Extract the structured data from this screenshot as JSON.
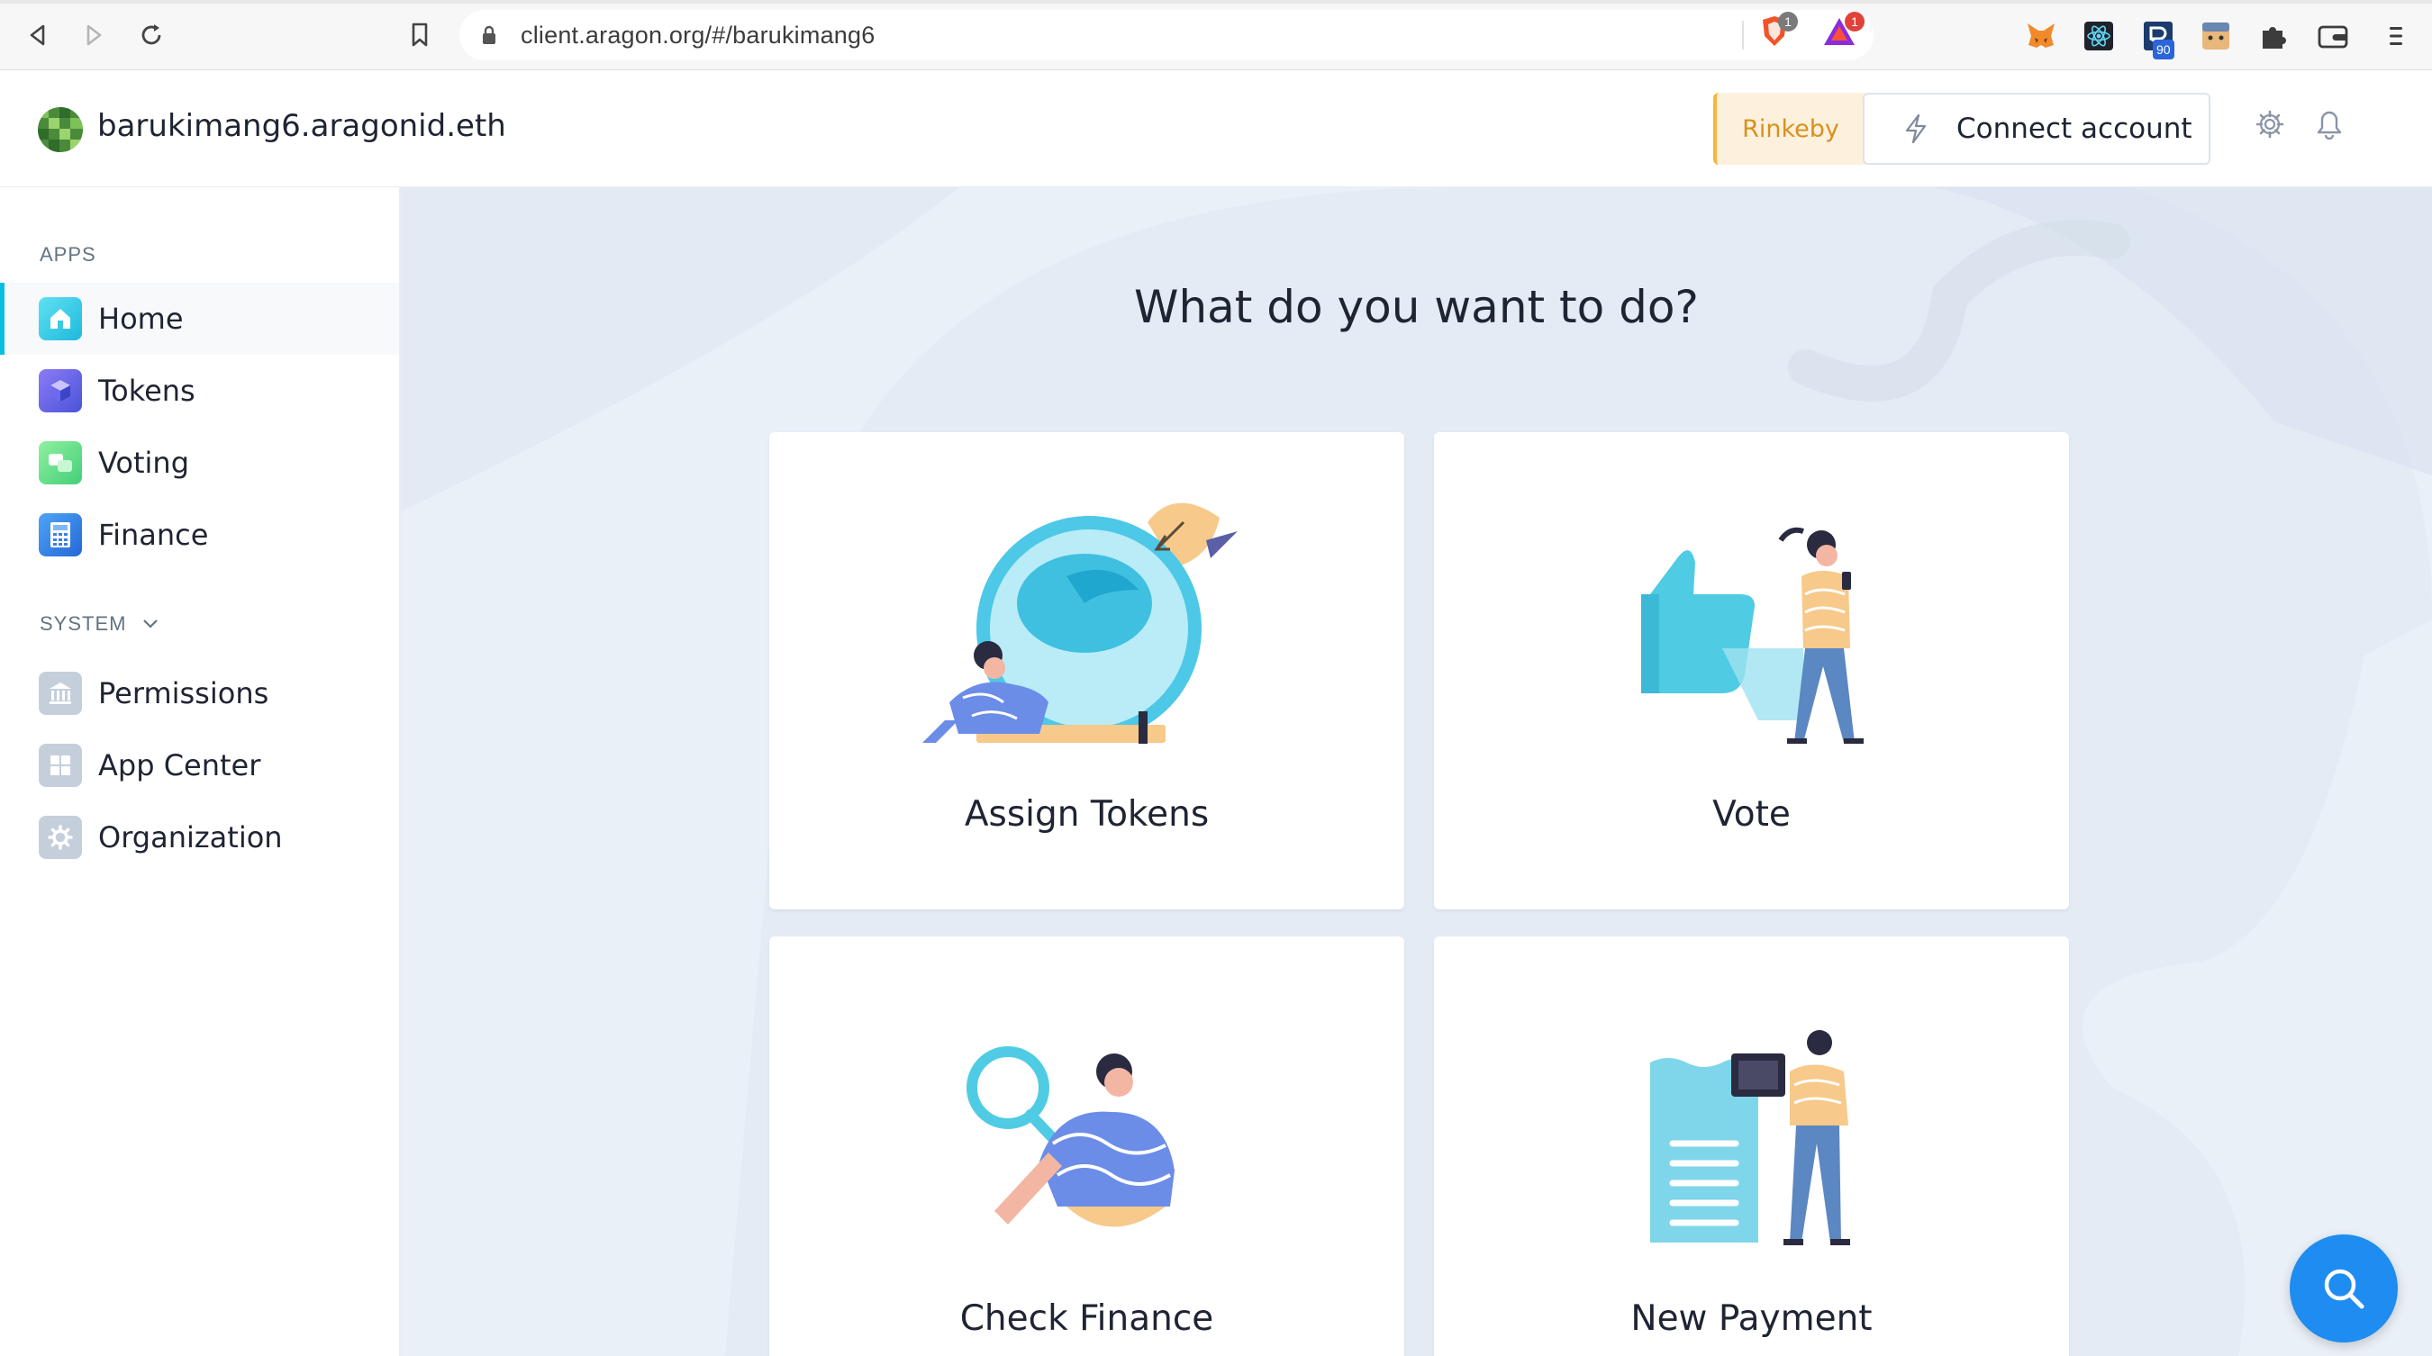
{
  "browser": {
    "url": "client.aragon.org/#/barukimang6",
    "brave_badge": "1",
    "rewards_badge": "1",
    "ext_badge": "90"
  },
  "header": {
    "org_name": "barukimang6.aragonid.eth",
    "network": "Rinkeby",
    "connect_label": "Connect account"
  },
  "sidebar": {
    "apps_label": "APPS",
    "apps": [
      {
        "label": "Home",
        "icon": "home-icon"
      },
      {
        "label": "Tokens",
        "icon": "tokens-icon"
      },
      {
        "label": "Voting",
        "icon": "voting-icon"
      },
      {
        "label": "Finance",
        "icon": "finance-icon"
      }
    ],
    "system_label": "SYSTEM",
    "system": [
      {
        "label": "Permissions",
        "icon": "permissions-icon"
      },
      {
        "label": "App Center",
        "icon": "app-center-icon"
      },
      {
        "label": "Organization",
        "icon": "organization-icon"
      }
    ]
  },
  "main": {
    "title": "What do you want to do?",
    "cards": [
      {
        "label": "Assign Tokens"
      },
      {
        "label": "Vote"
      },
      {
        "label": "Check Finance"
      },
      {
        "label": "New Payment"
      }
    ]
  },
  "colors": {
    "accent": "#08bee5",
    "network_text": "#d9901e",
    "fab": "#1e8cf0",
    "main_bg": "#eaf0f7"
  }
}
